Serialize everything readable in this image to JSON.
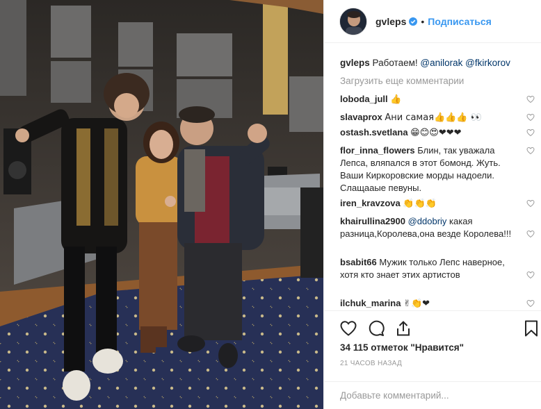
{
  "post": {
    "username": "gvleps",
    "follow_label": "Подписаться",
    "separator": "•",
    "caption_text": "Работаем!",
    "caption_mentions": [
      "@anilorak",
      "@fkirkorov"
    ],
    "load_more": "Загрузить еще комментарии",
    "likes": "34 115 отметок \"Нравится\"",
    "timestamp": "21 ЧАСОВ НАЗАД",
    "comment_placeholder": "Добавьте комментарий..."
  },
  "comments": [
    {
      "user": "loboda_jull",
      "text": "👍"
    },
    {
      "user": "slavaprox",
      "text": "Ани самая👍👍👍 👀"
    },
    {
      "user": "ostash.svetlana",
      "text": "😁😊😍❤❤❤"
    },
    {
      "user": "flor_inna_flowers",
      "text": "Блин, так уважала Лепса, вляпался в этот бомонд. Жуть. Ваши Киркоровские морды надоели. Слащааые певуны."
    },
    {
      "user": "iren_kravzova",
      "text": "👏👏👏"
    },
    {
      "user": "khairullina2900",
      "mention": "@ddobriy",
      "text": "какая разница,Королева,она везде Королева!!!"
    },
    {
      "user": "bsabit66",
      "text": "Мужик только Лепс наверное, хотя кто знает этих артистов"
    },
    {
      "user": "ilchuk_marina",
      "text": "✌👏❤"
    }
  ],
  "colors": {
    "link_blue": "#3897f0",
    "mention": "#003569",
    "muted": "#999999",
    "heart_red": "#ed4956",
    "border": "#efefef"
  },
  "icons": {
    "like": "heart-icon",
    "comment": "comment-bubble-icon",
    "share": "share-icon",
    "save": "bookmark-icon",
    "verified": "verified-badge-icon",
    "comment_like": "heart-outline-small-icon"
  }
}
